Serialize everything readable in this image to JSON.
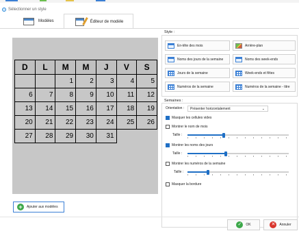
{
  "window": {
    "title": "Sélectionner un style"
  },
  "tabs": [
    {
      "label": "Modèles",
      "icon": "template-doc-icon",
      "active": false
    },
    {
      "label": "Éditeur de modèle",
      "icon": "editor-pen-icon",
      "active": true
    }
  ],
  "calendar": {
    "headers": [
      "D",
      "L",
      "M",
      "M",
      "J",
      "V",
      "S"
    ],
    "weeks": [
      [
        "",
        "",
        "1",
        "2",
        "3",
        "4",
        "5"
      ],
      [
        "6",
        "7",
        "8",
        "9",
        "10",
        "11",
        "12"
      ],
      [
        "13",
        "14",
        "15",
        "16",
        "17",
        "18",
        "19"
      ],
      [
        "20",
        "21",
        "22",
        "23",
        "24",
        "25",
        "26"
      ],
      [
        "27",
        "28",
        "29",
        "30",
        "31"
      ]
    ]
  },
  "style": {
    "label": "Style :",
    "buttons": [
      {
        "label": "En-tête des mois",
        "icon": "month-header-icon"
      },
      {
        "label": "Arrière-plan",
        "icon": "background-image-icon"
      },
      {
        "label": "Noms des jours de la semaine",
        "icon": "weekday-names-icon"
      },
      {
        "label": "Noms des week-ends",
        "icon": "weekend-names-icon"
      },
      {
        "label": "Jours de la semaine",
        "icon": "weekdays-grid-icon"
      },
      {
        "label": "Week-ends et fêtes",
        "icon": "weekends-holidays-icon"
      },
      {
        "label": "Numéros de la semaine",
        "icon": "week-numbers-icon"
      },
      {
        "label": "Numéros de la semaine - titre",
        "icon": "week-numbers-title-icon"
      }
    ]
  },
  "weeks": {
    "label": "Semaines :",
    "orientation_label": "Orientation :",
    "orientation_value": "Présenter horizontalement",
    "hide_empty": {
      "label": "Masquer les cellules vides",
      "checked": true
    },
    "show_month_name": {
      "label": "Montrer le nom de mois",
      "checked": false
    },
    "show_day_names": {
      "label": "Montrer les noms des jours",
      "checked": true
    },
    "show_week_numbers": {
      "label": "Montrer les numéros de la semaine",
      "checked": false
    },
    "hide_border": {
      "label": "Masquer la bordure",
      "checked": false
    },
    "size_label": "Taille :",
    "sliders": [
      0.36,
      0.38,
      0.2
    ]
  },
  "actions": {
    "add_to_templates": "Ajouter aux modèles",
    "ok": "OK",
    "cancel": "Annuler"
  }
}
